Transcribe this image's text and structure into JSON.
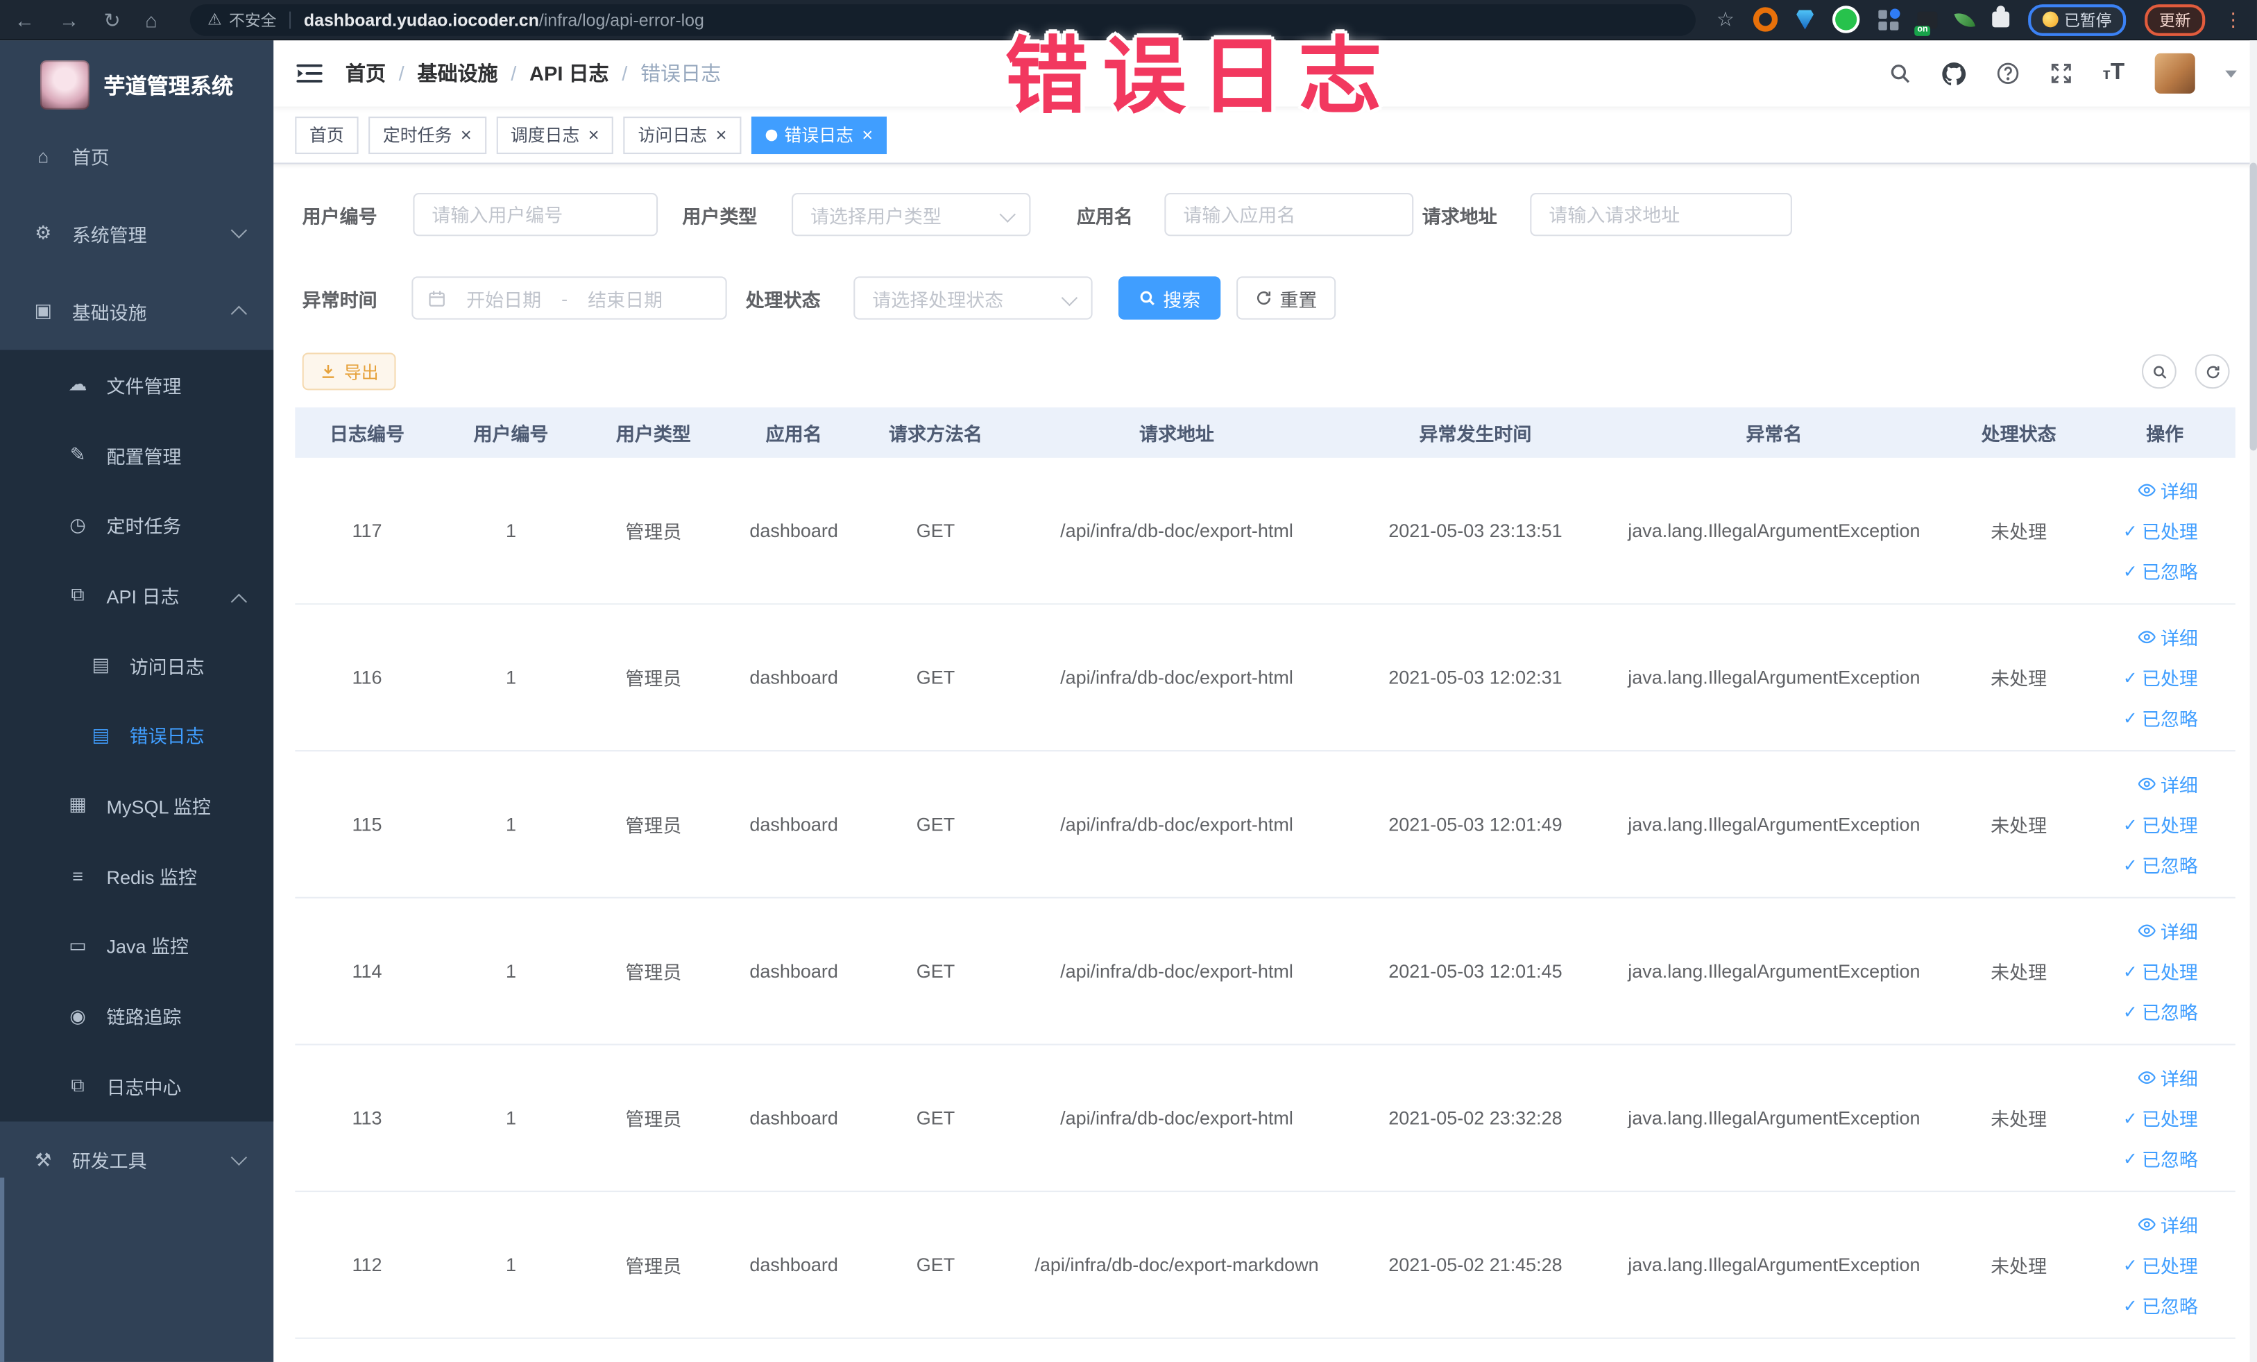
{
  "icons": {
    "back": "←",
    "forward": "→",
    "reload": "↻",
    "home_nav": "⌂",
    "warning": "⚠",
    "star": "☆",
    "dots": "⋮",
    "home": "⌂",
    "gear": "⚙",
    "monitor": "▣",
    "cloud": "☁",
    "edit": "✎",
    "clock": "◷",
    "log": "⧉",
    "doc": "▤",
    "db": "▦",
    "stack": "≡",
    "screen": "▭",
    "eye": "◉",
    "tools": "⚒"
  },
  "browser": {
    "security_warning": "不安全",
    "url_domain": "dashboard.yudao.iocoder.cn",
    "url_path": "/infra/log/api-error-log",
    "ext_on_badge": "on",
    "paused_pill": "已暂停",
    "update_pill": "更新"
  },
  "annotation": {
    "text": "错误日志",
    "color": "#f2385f"
  },
  "sidebar": {
    "title": "芋道管理系统",
    "items": [
      {
        "label": "首页",
        "level": 1,
        "icon": "home",
        "in_submenu": false
      },
      {
        "label": "系统管理",
        "level": 1,
        "icon": "gear",
        "arrow": "down",
        "in_submenu": false
      },
      {
        "label": "基础设施",
        "level": 1,
        "icon": "monitor",
        "arrow": "up",
        "in_submenu": false
      },
      {
        "label": "文件管理",
        "level": 2,
        "icon": "cloud",
        "in_submenu": true
      },
      {
        "label": "配置管理",
        "level": 2,
        "icon": "edit",
        "in_submenu": true
      },
      {
        "label": "定时任务",
        "level": 2,
        "icon": "clock",
        "in_submenu": true
      },
      {
        "label": "API 日志",
        "level": 2,
        "icon": "log",
        "arrow": "up",
        "in_submenu": true
      },
      {
        "label": "访问日志",
        "level": 3,
        "icon": "doc",
        "in_submenu": true
      },
      {
        "label": "错误日志",
        "level": 3,
        "icon": "doc",
        "active": true,
        "in_submenu": true
      },
      {
        "label": "MySQL 监控",
        "level": 2,
        "icon": "db",
        "in_submenu": true
      },
      {
        "label": "Redis 监控",
        "level": 2,
        "icon": "stack",
        "in_submenu": true
      },
      {
        "label": "Java 监控",
        "level": 2,
        "icon": "screen",
        "in_submenu": true
      },
      {
        "label": "链路追踪",
        "level": 2,
        "icon": "eye",
        "in_submenu": true
      },
      {
        "label": "日志中心",
        "level": 2,
        "icon": "log",
        "in_submenu": true
      },
      {
        "label": "研发工具",
        "level": 1,
        "icon": "tools",
        "arrow": "down",
        "in_submenu": false
      }
    ]
  },
  "header": {
    "breadcrumb": [
      "首页",
      "基础设施",
      "API 日志",
      "错误日志"
    ]
  },
  "tabs": [
    {
      "label": "首页",
      "closable": false,
      "active": false
    },
    {
      "label": "定时任务",
      "closable": true,
      "active": false
    },
    {
      "label": "调度日志",
      "closable": true,
      "active": false
    },
    {
      "label": "访问日志",
      "closable": true,
      "active": false
    },
    {
      "label": "错误日志",
      "closable": true,
      "active": true
    }
  ],
  "filters": {
    "user_id_label": "用户编号",
    "user_id_placeholder": "请输入用户编号",
    "user_type_label": "用户类型",
    "user_type_placeholder": "请选择用户类型",
    "app_name_label": "应用名",
    "app_name_placeholder": "请输入应用名",
    "request_url_label": "请求地址",
    "request_url_placeholder": "请输入请求地址",
    "exception_time_label": "异常时间",
    "date_start_placeholder": "开始日期",
    "date_separator": "-",
    "date_end_placeholder": "结束日期",
    "process_status_label": "处理状态",
    "process_status_placeholder": "请选择处理状态",
    "search_label": "搜索",
    "reset_label": "重置"
  },
  "toolbar": {
    "export_label": "导出"
  },
  "table": {
    "columns": [
      "日志编号",
      "用户编号",
      "用户类型",
      "应用名",
      "请求方法名",
      "请求地址",
      "异常发生时间",
      "异常名",
      "处理状态",
      "操作"
    ],
    "action_labels": [
      "详细",
      "已处理",
      "已忽略"
    ],
    "rows": [
      {
        "id": "117",
        "user_id": "1",
        "user_type": "管理员",
        "app_name": "dashboard",
        "method": "GET",
        "url": "/api/infra/db-doc/export-html",
        "time": "2021-05-03 23:13:51",
        "exception": "java.lang.IllegalArgumentException",
        "status": "未处理"
      },
      {
        "id": "116",
        "user_id": "1",
        "user_type": "管理员",
        "app_name": "dashboard",
        "method": "GET",
        "url": "/api/infra/db-doc/export-html",
        "time": "2021-05-03 12:02:31",
        "exception": "java.lang.IllegalArgumentException",
        "status": "未处理"
      },
      {
        "id": "115",
        "user_id": "1",
        "user_type": "管理员",
        "app_name": "dashboard",
        "method": "GET",
        "url": "/api/infra/db-doc/export-html",
        "time": "2021-05-03 12:01:49",
        "exception": "java.lang.IllegalArgumentException",
        "status": "未处理"
      },
      {
        "id": "114",
        "user_id": "1",
        "user_type": "管理员",
        "app_name": "dashboard",
        "method": "GET",
        "url": "/api/infra/db-doc/export-html",
        "time": "2021-05-03 12:01:45",
        "exception": "java.lang.IllegalArgumentException",
        "status": "未处理"
      },
      {
        "id": "113",
        "user_id": "1",
        "user_type": "管理员",
        "app_name": "dashboard",
        "method": "GET",
        "url": "/api/infra/db-doc/export-html",
        "time": "2021-05-02 23:32:28",
        "exception": "java.lang.IllegalArgumentException",
        "status": "未处理"
      },
      {
        "id": "112",
        "user_id": "1",
        "user_type": "管理员",
        "app_name": "dashboard",
        "method": "GET",
        "url": "/api/infra/db-doc/export-markdown",
        "time": "2021-05-02 21:45:28",
        "exception": "java.lang.IllegalArgumentException",
        "status": "未处理"
      }
    ]
  }
}
